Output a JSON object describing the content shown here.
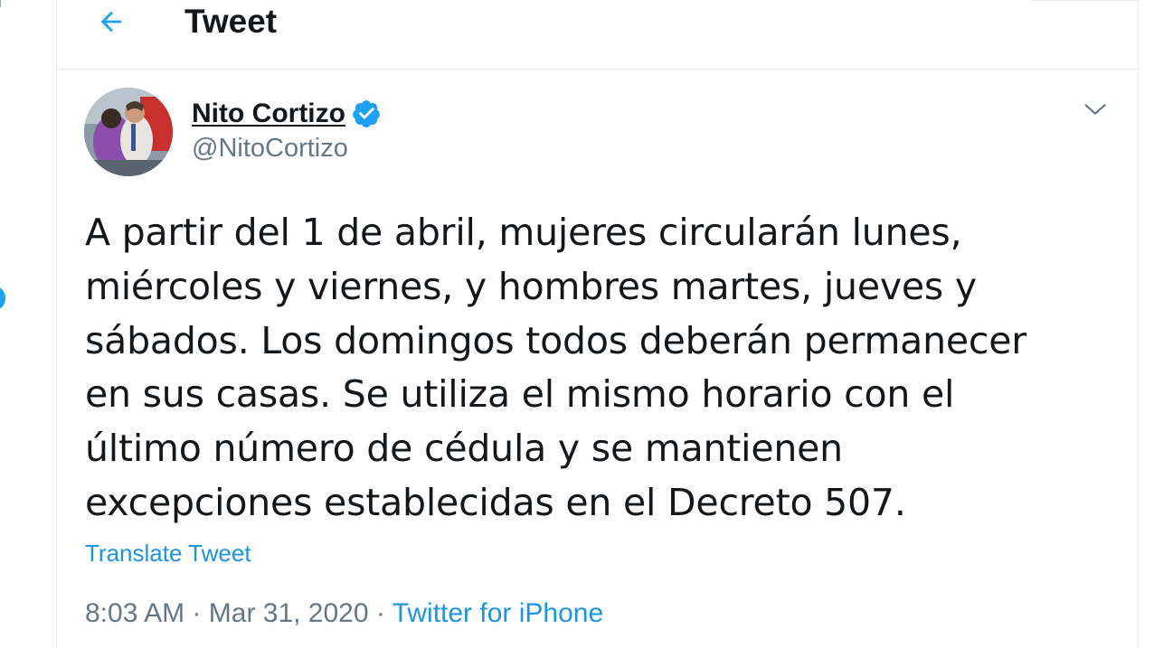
{
  "header": {
    "title": "Tweet",
    "back_icon": "arrow-left-icon"
  },
  "tweet": {
    "author": {
      "name": "Nito Cortizo",
      "handle": "@NitoCortizo",
      "verified_icon": "verified-badge-icon"
    },
    "menu_icon": "chevron-down-icon",
    "text": "A partir del 1 de abril, mujeres circularán lunes,\nmiércoles y viernes, y hombres martes, jueves y\nsábados. Los domingos todos deberán permanecer\nen sus casas. Se utiliza el mismo horario con el\núltimo número de cédula y se mantienen\nexcepciones establecidas en el Decreto 507.",
    "translate_label": "Translate Tweet",
    "time": "8:03 AM",
    "date": "Mar 31, 2020",
    "separator": "·",
    "source": "Twitter for iPhone"
  },
  "colors": {
    "accent": "#1da1f2",
    "link": "#1b95e0",
    "text": "#14171a",
    "secondary": "#657786",
    "border": "#e6ecf0"
  }
}
